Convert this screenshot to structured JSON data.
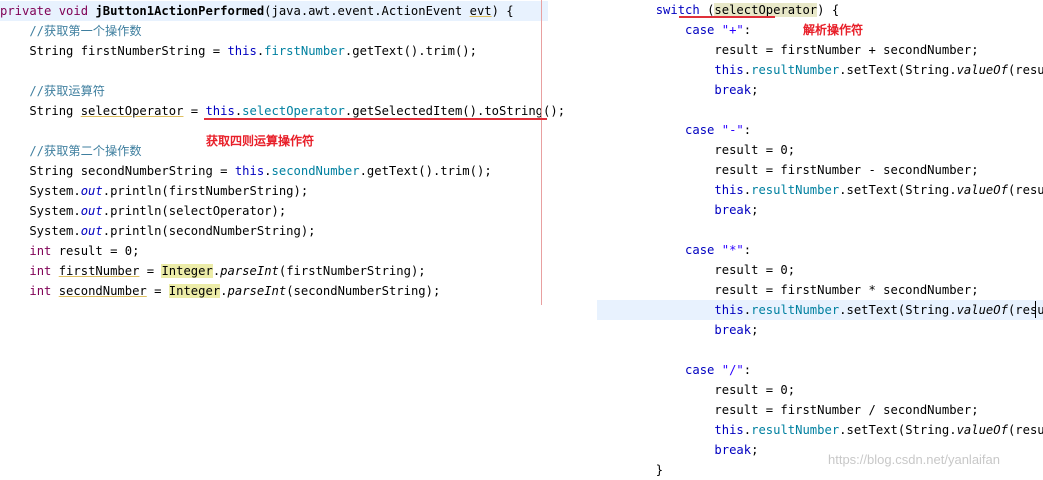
{
  "left": {
    "lines": [
      {
        "parts": [
          {
            "t": "private void ",
            "c": "kw"
          },
          {
            "t": "jButton1ActionPerformed",
            "c": "bold"
          },
          {
            "t": "(java.awt.event.ActionEvent ",
            "c": ""
          },
          {
            "t": "evt",
            "c": "underline-wavy"
          },
          {
            "t": ") {",
            "c": ""
          }
        ]
      },
      {
        "parts": [
          {
            "t": "    //获取第一个操作数",
            "c": "cm"
          }
        ]
      },
      {
        "parts": [
          {
            "t": "    String firstNumberString = ",
            "c": ""
          },
          {
            "t": "this",
            "c": "kwb"
          },
          {
            "t": ".",
            "c": ""
          },
          {
            "t": "firstNumber",
            "c": "field"
          },
          {
            "t": ".getText().trim();",
            "c": ""
          }
        ]
      },
      {
        "parts": [
          {
            "t": "",
            "c": ""
          }
        ]
      },
      {
        "parts": [
          {
            "t": "    //获取运算符",
            "c": "cm"
          }
        ]
      },
      {
        "parts": [
          {
            "t": "    String ",
            "c": ""
          },
          {
            "t": "selectOperator",
            "c": "underline-wavy"
          },
          {
            "t": " = ",
            "c": ""
          },
          {
            "t": "this",
            "c": "kwb"
          },
          {
            "t": ".",
            "c": ""
          },
          {
            "t": "selectOperator",
            "c": "field"
          },
          {
            "t": ".getSelectedItem().toString();",
            "c": ""
          }
        ]
      },
      {
        "parts": [
          {
            "t": "",
            "c": ""
          }
        ]
      },
      {
        "parts": [
          {
            "t": "    //获取第二个操作数",
            "c": "cm"
          }
        ]
      },
      {
        "parts": [
          {
            "t": "    String secondNumberString = ",
            "c": ""
          },
          {
            "t": "this",
            "c": "kwb"
          },
          {
            "t": ".",
            "c": ""
          },
          {
            "t": "secondNumber",
            "c": "field"
          },
          {
            "t": ".getText().trim();",
            "c": ""
          }
        ]
      },
      {
        "parts": [
          {
            "t": "    System.",
            "c": ""
          },
          {
            "t": "out",
            "c": "static"
          },
          {
            "t": ".println(firstNumberString);",
            "c": ""
          }
        ]
      },
      {
        "parts": [
          {
            "t": "    System.",
            "c": ""
          },
          {
            "t": "out",
            "c": "static"
          },
          {
            "t": ".println(selectOperator);",
            "c": ""
          }
        ]
      },
      {
        "parts": [
          {
            "t": "    System.",
            "c": ""
          },
          {
            "t": "out",
            "c": "static"
          },
          {
            "t": ".println(secondNumberString);",
            "c": ""
          }
        ]
      },
      {
        "parts": [
          {
            "t": "    ",
            "c": ""
          },
          {
            "t": "int",
            "c": "kw"
          },
          {
            "t": " result = 0;",
            "c": ""
          }
        ]
      },
      {
        "parts": [
          {
            "t": "    ",
            "c": ""
          },
          {
            "t": "int",
            "c": "kw"
          },
          {
            "t": " ",
            "c": ""
          },
          {
            "t": "firstNumber",
            "c": "underline-wavy"
          },
          {
            "t": " = ",
            "c": ""
          },
          {
            "t": "Integer",
            "c": "occ-strong"
          },
          {
            "t": ".",
            "c": ""
          },
          {
            "t": "parseInt",
            "c": "italic"
          },
          {
            "t": "(firstNumberString);",
            "c": ""
          }
        ]
      },
      {
        "parts": [
          {
            "t": "    ",
            "c": ""
          },
          {
            "t": "int",
            "c": "kw"
          },
          {
            "t": " ",
            "c": ""
          },
          {
            "t": "secondNumber",
            "c": "underline-wavy"
          },
          {
            "t": " = ",
            "c": ""
          },
          {
            "t": "Integer",
            "c": "occ-strong"
          },
          {
            "t": ".",
            "c": ""
          },
          {
            "t": "parseInt",
            "c": "italic"
          },
          {
            "t": "(secondNumberString);",
            "c": ""
          }
        ]
      }
    ],
    "annotation": "获取四则运算操作符"
  },
  "right": {
    "lines": [
      {
        "parts": [
          {
            "t": "        switch",
            "c": "kwb"
          },
          {
            "t": " (",
            "c": ""
          },
          {
            "t": "selectOperator",
            "c": "occ"
          },
          {
            "t": ") {",
            "c": ""
          }
        ]
      },
      {
        "parts": [
          {
            "t": "            case",
            "c": "kwb"
          },
          {
            "t": " ",
            "c": ""
          },
          {
            "t": "\"+\"",
            "c": "str"
          },
          {
            "t": ":",
            "c": ""
          }
        ]
      },
      {
        "parts": [
          {
            "t": "                result = firstNumber + secondNumber;",
            "c": ""
          }
        ]
      },
      {
        "parts": [
          {
            "t": "                ",
            "c": ""
          },
          {
            "t": "this",
            "c": "kwb"
          },
          {
            "t": ".",
            "c": ""
          },
          {
            "t": "resultNumber",
            "c": "field"
          },
          {
            "t": ".setText(String.",
            "c": ""
          },
          {
            "t": "valueOf",
            "c": "italic"
          },
          {
            "t": "(result));",
            "c": ""
          }
        ]
      },
      {
        "parts": [
          {
            "t": "                break",
            "c": "kwb"
          },
          {
            "t": ";",
            "c": ""
          }
        ]
      },
      {
        "parts": [
          {
            "t": "",
            "c": ""
          }
        ]
      },
      {
        "parts": [
          {
            "t": "            case",
            "c": "kwb"
          },
          {
            "t": " ",
            "c": ""
          },
          {
            "t": "\"-\"",
            "c": "str"
          },
          {
            "t": ":",
            "c": ""
          }
        ]
      },
      {
        "parts": [
          {
            "t": "                result = 0;",
            "c": ""
          }
        ]
      },
      {
        "parts": [
          {
            "t": "                result = firstNumber - secondNumber;",
            "c": ""
          }
        ]
      },
      {
        "parts": [
          {
            "t": "                ",
            "c": ""
          },
          {
            "t": "this",
            "c": "kwb"
          },
          {
            "t": ".",
            "c": ""
          },
          {
            "t": "resultNumber",
            "c": "field"
          },
          {
            "t": ".setText(String.",
            "c": ""
          },
          {
            "t": "valueOf",
            "c": "italic"
          },
          {
            "t": "(result));",
            "c": ""
          }
        ]
      },
      {
        "parts": [
          {
            "t": "                break",
            "c": "kwb"
          },
          {
            "t": ";",
            "c": ""
          }
        ]
      },
      {
        "parts": [
          {
            "t": "",
            "c": ""
          }
        ]
      },
      {
        "parts": [
          {
            "t": "            case",
            "c": "kwb"
          },
          {
            "t": " ",
            "c": ""
          },
          {
            "t": "\"*\"",
            "c": "str"
          },
          {
            "t": ":",
            "c": ""
          }
        ]
      },
      {
        "parts": [
          {
            "t": "                result = 0;",
            "c": ""
          }
        ]
      },
      {
        "parts": [
          {
            "t": "                result = firstNumber * secondNumber;",
            "c": ""
          }
        ]
      },
      {
        "parts": [
          {
            "t": "                ",
            "c": ""
          },
          {
            "t": "this",
            "c": "kwb"
          },
          {
            "t": ".",
            "c": ""
          },
          {
            "t": "resultNumber",
            "c": "field"
          },
          {
            "t": ".setText(String.",
            "c": ""
          },
          {
            "t": "valueOf",
            "c": "italic"
          },
          {
            "t": "(result));",
            "c": ""
          }
        ]
      },
      {
        "parts": [
          {
            "t": "                break",
            "c": "kwb"
          },
          {
            "t": ";",
            "c": ""
          }
        ]
      },
      {
        "parts": [
          {
            "t": "",
            "c": ""
          }
        ]
      },
      {
        "parts": [
          {
            "t": "            case",
            "c": "kwb"
          },
          {
            "t": " ",
            "c": ""
          },
          {
            "t": "\"/\"",
            "c": "str"
          },
          {
            "t": ":",
            "c": ""
          }
        ]
      },
      {
        "parts": [
          {
            "t": "                result = 0;",
            "c": ""
          }
        ]
      },
      {
        "parts": [
          {
            "t": "                result = firstNumber / secondNumber;",
            "c": ""
          }
        ]
      },
      {
        "parts": [
          {
            "t": "                ",
            "c": ""
          },
          {
            "t": "this",
            "c": "kwb"
          },
          {
            "t": ".",
            "c": ""
          },
          {
            "t": "resultNumber",
            "c": "field"
          },
          {
            "t": ".setText(String.",
            "c": ""
          },
          {
            "t": "valueOf",
            "c": "italic"
          },
          {
            "t": "(result));",
            "c": ""
          }
        ]
      },
      {
        "parts": [
          {
            "t": "                break",
            "c": "kwb"
          },
          {
            "t": ";",
            "c": ""
          }
        ]
      },
      {
        "parts": [
          {
            "t": "        }",
            "c": ""
          }
        ]
      }
    ],
    "annotation": "解析操作符"
  },
  "watermark": "https://blog.csdn.net/yanlaifan",
  "colors": {
    "annotation": "#e8202a",
    "keyword": "#7f0055",
    "field": "#0080a0",
    "comment": "#3f7f9f",
    "string": "#2a00ff",
    "current_line": "#e8f2fe"
  }
}
